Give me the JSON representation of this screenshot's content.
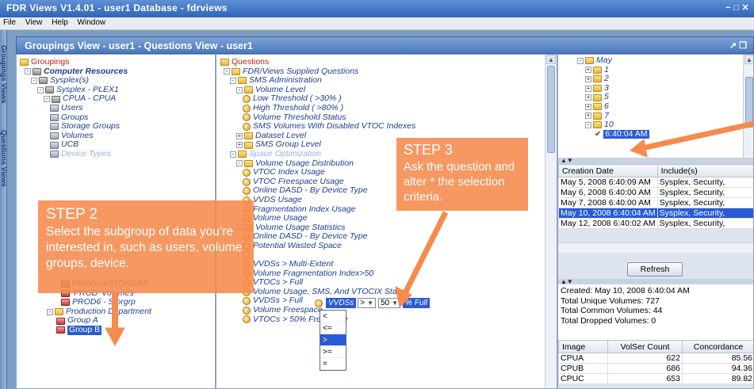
{
  "window": {
    "title": "FDR Views V1.4.01 - user1   Database - fdrviews",
    "controls": "− □ ✕"
  },
  "menu": [
    "File",
    "View",
    "Help",
    "Window"
  ],
  "side_tabs": [
    "Groupings Views",
    "Questions Views"
  ],
  "view_header": {
    "title": "Groupings View - user1  -  Questions View - user1",
    "controls": "↗ ❒"
  },
  "groupings_tree": [
    {
      "label": "Groupings",
      "icon": "folder",
      "root": true
    },
    {
      "label": "Computer Resources",
      "icon": "sys",
      "bold": true,
      "exp": "-"
    },
    {
      "label": "Sysplex(s)",
      "icon": "sys",
      "exp": "-"
    },
    {
      "label": "Sysplex - PLEX1",
      "icon": "sys",
      "exp": "-"
    },
    {
      "label": "CPUA - CPUA",
      "icon": "sys",
      "exp": "-"
    },
    {
      "label": "Users",
      "icon": "user"
    },
    {
      "label": "Groups",
      "icon": "user"
    },
    {
      "label": "Storage Groups",
      "icon": "user"
    },
    {
      "label": "Volumes",
      "icon": "user"
    },
    {
      "label": "UCB",
      "icon": "user"
    },
    {
      "label": "Device Types",
      "icon": "user",
      "dim": true
    }
  ],
  "groupings_tree_bottom": [
    {
      "label": "PRODnmSTORGRP",
      "icon": "grp"
    },
    {
      "label": "'PROD' Volumes",
      "icon": "grp"
    },
    {
      "label": "PROD6 - Storgrp",
      "icon": "grp"
    },
    {
      "label": "Production Department",
      "icon": "folder",
      "exp": "-"
    },
    {
      "label": "Group A",
      "icon": "grp"
    },
    {
      "label": "Group B",
      "icon": "grp",
      "sel": true
    }
  ],
  "questions_tree": [
    {
      "label": "Questions",
      "icon": "folder",
      "root": true
    },
    {
      "label": "FDR/Views Supplied Questions",
      "icon": "folder",
      "exp": "-"
    },
    {
      "label": "SMS Administration",
      "icon": "folder",
      "exp": "-"
    },
    {
      "label": "Volume Level",
      "icon": "folder",
      "exp": "-"
    },
    {
      "label": "Low Threshold ( >30% )",
      "icon": "q"
    },
    {
      "label": "High Threshold ( >80% )",
      "icon": "q"
    },
    {
      "label": "Volume Threshold Status",
      "icon": "q"
    },
    {
      "label": "SMS Volumes With Disabled VTOC Indexes",
      "icon": "q"
    },
    {
      "label": "Dataset Level",
      "icon": "folder",
      "exp": "+"
    },
    {
      "label": "SMS Group Level",
      "icon": "folder",
      "exp": "+"
    },
    {
      "label": "Space Optimization",
      "icon": "folder",
      "exp": "-",
      "dim": true
    },
    {
      "label": "Volume Usage Distribution",
      "icon": "folder",
      "exp": "-"
    },
    {
      "label": "VTOC Index Usage",
      "icon": "q"
    },
    {
      "label": "VTOC Freespace Usage",
      "icon": "q"
    },
    {
      "label": "Online DASD - By Device Type",
      "icon": "q"
    },
    {
      "label": "VVDS Usage",
      "icon": "q"
    },
    {
      "label": "Fragmentation Index Usage",
      "icon": "q"
    },
    {
      "label": "Volume Usage",
      "icon": "q"
    },
    {
      "label": "Volume Usage Statistics",
      "icon": "folder",
      "exp": "-"
    },
    {
      "label": "Online DASD - By Device Type",
      "icon": "q"
    },
    {
      "label": "Potential Wasted Space",
      "icon": "q"
    },
    {
      "label": "",
      "icon": "q"
    },
    {
      "label": "VVDSs > Multi-Extent",
      "icon": "q"
    },
    {
      "label": "Volume Fragmentation Index>50",
      "icon": "q"
    },
    {
      "label": "VTOCs > Full",
      "icon": "q"
    },
    {
      "label": "Volume Usage, SMS, And VTOCIX Status",
      "icon": "q"
    },
    {
      "label": "VVDSs > Full",
      "icon": "q"
    },
    {
      "label": "Volume Freespace",
      "icon": "q"
    },
    {
      "label": "VTOCs > 50% Freespace",
      "icon": "q"
    }
  ],
  "criteria_editor": {
    "field": "VVDSs",
    "operator": ">",
    "value": "50",
    "unit": "% Full",
    "operators": [
      "<",
      "<=",
      ">",
      ">=",
      "="
    ],
    "highlighted": ">"
  },
  "date_tree": [
    {
      "label": "May",
      "icon": "folder",
      "exp": "-"
    },
    {
      "label": "1",
      "icon": "folder",
      "exp": "+"
    },
    {
      "label": "2",
      "icon": "folder",
      "exp": "+"
    },
    {
      "label": "3",
      "icon": "folder",
      "exp": "+"
    },
    {
      "label": "5",
      "icon": "folder",
      "exp": "+"
    },
    {
      "label": "6",
      "icon": "folder",
      "exp": "+"
    },
    {
      "label": "7",
      "icon": "folder",
      "exp": "+"
    },
    {
      "label": "10",
      "icon": "folder",
      "exp": "-"
    },
    {
      "label": "6:40:04 AM",
      "icon": "check",
      "sel": true
    }
  ],
  "runs_table": {
    "headers": [
      "Creation Date",
      "Include(s)"
    ],
    "rows": [
      {
        "date": "May 5, 2008 6:40:09 AM",
        "inc": "Sysplex, Security,"
      },
      {
        "date": "May 6, 2008 6:40:00 AM",
        "inc": "Sysplex, Security,"
      },
      {
        "date": "May 7, 2008 6:40:00 AM",
        "inc": "Sysplex, Security,"
      },
      {
        "date": "May 10, 2008 6:40:04 AM",
        "inc": "Sysplex, Security,",
        "sel": true
      },
      {
        "date": "May 12, 2008 6:40:02 AM",
        "inc": "Sysplex, Security,"
      }
    ]
  },
  "refresh_label": "Refresh",
  "summary": {
    "created": "Created: May 10, 2008 6:40:04 AM",
    "unique": "Total Unique Volumes: 727",
    "common": "Total Common Volumes: 44",
    "dropped": "Total Dropped Volumes: 0"
  },
  "images_table": {
    "headers": [
      "Image",
      "VolSer Count",
      "Concordance"
    ],
    "rows": [
      {
        "image": "CPUA",
        "count": "622",
        "conc": "85.56"
      },
      {
        "image": "CPUB",
        "count": "686",
        "conc": "94.36"
      },
      {
        "image": "CPUC",
        "count": "653",
        "conc": "89.82"
      }
    ]
  },
  "step2": {
    "title": "STEP 2",
    "text": "Select the subgroup of data you’re interested in, such as users, volume groups, device."
  },
  "step3": {
    "title": "STEP 3",
    "text": "Ask the question and alter * the selection criteria."
  },
  "colors": {
    "annotation": "#f68a4c",
    "selection": "#2a5bd4",
    "header": "#4a78bd"
  }
}
